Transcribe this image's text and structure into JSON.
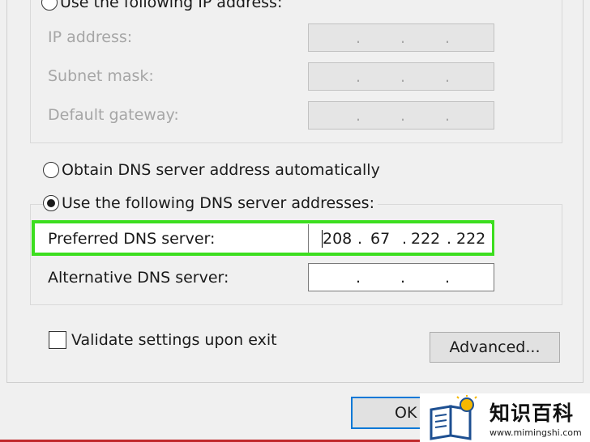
{
  "ip_section": {
    "use_following_ip_label": "Use the following IP address:",
    "ip_address_label": "IP address:",
    "subnet_mask_label": "Subnet mask:",
    "default_gateway_label": "Default gateway:"
  },
  "dns_section": {
    "obtain_auto_label": "Obtain DNS server address automatically",
    "use_following_label": "Use the following DNS server addresses:",
    "preferred_label": "Preferred DNS server:",
    "preferred_value": [
      "208",
      "67",
      "222",
      "222"
    ],
    "alternative_label": "Alternative DNS server:",
    "selected_option": "use_following"
  },
  "validate_label": "Validate settings upon exit",
  "validate_checked": false,
  "buttons": {
    "advanced": "Advanced...",
    "ok": "OK"
  },
  "watermark": {
    "title": "知识百科",
    "url": "www.mimingshi.com"
  },
  "colors": {
    "highlight": "#3cde1f",
    "ok_border": "#0078d7"
  }
}
